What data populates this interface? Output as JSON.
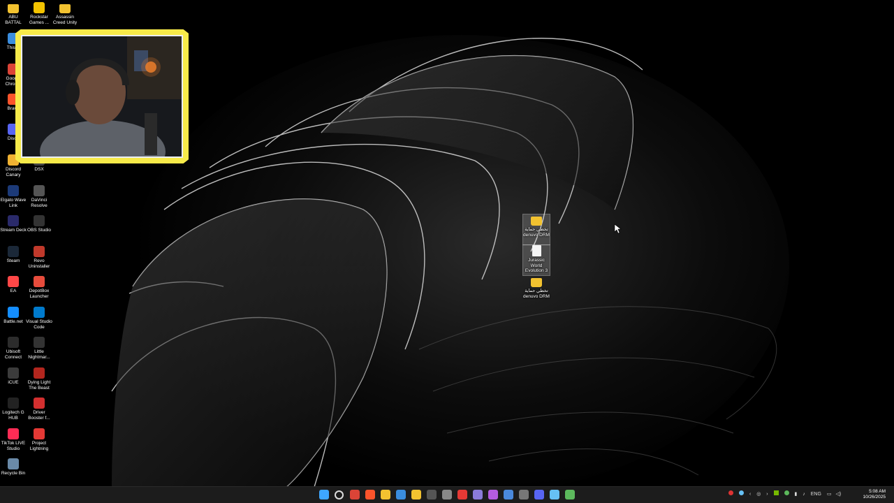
{
  "desktop": {
    "icons_col1": [
      {
        "label": "ABU BATTAL",
        "icon": "folder-icon",
        "color": "#f2c230"
      },
      {
        "label": "This P",
        "icon": "this-pc-icon",
        "color": "#3a8dde"
      },
      {
        "label": "Google Chrome",
        "icon": "chrome-icon",
        "color": "#db4437"
      },
      {
        "label": "Brave",
        "icon": "brave-icon",
        "color": "#fb542b"
      },
      {
        "label": "Disco",
        "icon": "discord-icon",
        "color": "#5865f2"
      },
      {
        "label": "Discord Canary",
        "icon": "discord-canary-icon",
        "color": "#f0b232"
      },
      {
        "label": "Elgato Wave Link",
        "icon": "wave-link-icon",
        "color": "#1c3a78"
      },
      {
        "label": "Stream Deck",
        "icon": "stream-deck-icon",
        "color": "#2a2a6a"
      },
      {
        "label": "Steam",
        "icon": "steam-icon",
        "color": "#1b2838"
      },
      {
        "label": "EA",
        "icon": "ea-icon",
        "color": "#ff4747"
      },
      {
        "label": "Battle.net",
        "icon": "battlenet-icon",
        "color": "#148eff"
      },
      {
        "label": "Ubisoft Connect",
        "icon": "ubisoft-icon",
        "color": "#2c2c2c"
      },
      {
        "label": "iCUE",
        "icon": "icue-icon",
        "color": "#3b3b3b"
      },
      {
        "label": "Logitech G HUB",
        "icon": "ghub-icon",
        "color": "#222"
      },
      {
        "label": "TikTok LIVE Studio",
        "icon": "tiktok-icon",
        "color": "#fe2c55"
      },
      {
        "label": "Recycle Bin",
        "icon": "recycle-bin-icon",
        "color": "#6a8aa8"
      }
    ],
    "icons_col2": [
      {
        "label": "Rockstar Games ...",
        "icon": "rockstar-icon",
        "color": "#f3c300"
      },
      {
        "label": "DSX",
        "icon": "dsx-icon",
        "color": "#444"
      },
      {
        "label": "DaVinci Resolve",
        "icon": "davinci-icon",
        "color": "#555"
      },
      {
        "label": "OBS Studio",
        "icon": "obs-icon",
        "color": "#333"
      },
      {
        "label": "Revo Uninstaller",
        "icon": "revo-icon",
        "color": "#c0392b"
      },
      {
        "label": "DepotBox Launcher",
        "icon": "depotbox-icon",
        "color": "#e74c3c"
      },
      {
        "label": "Visual Studio Code",
        "icon": "vscode-icon",
        "color": "#007acc"
      },
      {
        "label": "Little Nightmar...",
        "icon": "little-nightmares-icon",
        "color": "#333"
      },
      {
        "label": "Dying Light The Beast",
        "icon": "dying-light-icon",
        "color": "#b3261e"
      },
      {
        "label": "Driver Booster f...",
        "icon": "driver-booster-icon",
        "color": "#d32f2f"
      },
      {
        "label": "Project Lightning",
        "icon": "project-lightning-icon",
        "color": "#e53935"
      }
    ],
    "icons_col3": [
      {
        "label": "Assassin Creed Unity",
        "icon": "folder-icon",
        "color": "#f2c230"
      }
    ],
    "icons_center": [
      {
        "label": "تخطي حماية denuvo DRM",
        "icon": "folder-icon",
        "selected": true
      },
      {
        "label": "Jurassic World Evolution 3",
        "icon": "document-icon",
        "selected": true
      },
      {
        "label": "تخطي حماية denuvo DRM",
        "icon": "folder-icon",
        "selected": false
      }
    ]
  },
  "taskbar": {
    "apps": [
      {
        "name": "start-icon",
        "color": "#3ea6ff"
      },
      {
        "name": "search-icon",
        "color": "#ddd"
      },
      {
        "name": "chrome-icon",
        "color": "#db4437"
      },
      {
        "name": "brave-icon",
        "color": "#fb542b"
      },
      {
        "name": "file-explorer-icon",
        "color": "#f2c230"
      },
      {
        "name": "store-icon",
        "color": "#3a8dde"
      },
      {
        "name": "terminal-icon",
        "color": "#f2c230"
      },
      {
        "name": "obs-icon",
        "color": "#555"
      },
      {
        "name": "davinci-icon",
        "color": "#888"
      },
      {
        "name": "depotbox-icon",
        "color": "#e53935"
      },
      {
        "name": "app-icon",
        "color": "#8a7bd8"
      },
      {
        "name": "app-icon",
        "color": "#b55ce0"
      },
      {
        "name": "settings-icon",
        "color": "#4a89dc"
      },
      {
        "name": "mic-icon",
        "color": "#777"
      },
      {
        "name": "discord-icon",
        "color": "#5865f2"
      },
      {
        "name": "steam-icon",
        "color": "#66c0f4"
      },
      {
        "name": "notepad-icon",
        "color": "#5cb85c"
      }
    ],
    "tray": {
      "language": "ENG",
      "time": "5:08 AM",
      "date": "10/26/2025"
    }
  }
}
